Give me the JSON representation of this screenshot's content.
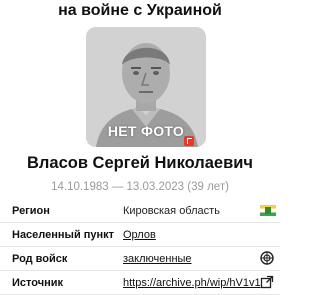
{
  "header": {
    "title": "на войне с Украиной"
  },
  "photo": {
    "label": "НЕТ ФОТО"
  },
  "person": {
    "name": "Власов Сергей Николаевич",
    "dates": "14.10.1983 — 13.03.2023 (39 лет)"
  },
  "details": {
    "region": {
      "label": "Регион",
      "value": "Кировская область",
      "icon": "region-flag-icon"
    },
    "settlement": {
      "label": "Населенный пункт",
      "value": "Орлов"
    },
    "service": {
      "label": "Род войск",
      "value": "заключенные",
      "icon": "prisoner-emblem-icon"
    },
    "source": {
      "label": "Источник",
      "value": "https://archive.ph/wip/hV1v1",
      "icon": "external-link-icon"
    }
  },
  "colors": {
    "accent": "#e23b2e",
    "muted": "#9a9a9a",
    "divider": "#e6e6e6"
  }
}
